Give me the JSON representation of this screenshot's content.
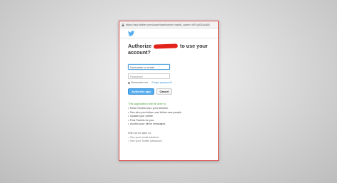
{
  "browser": {
    "url": "https://api.twitter.com/oauth/authorize?oauth_token=WCqXDAAAA"
  },
  "brand": {
    "logo_icon": "twitter-bird-icon",
    "color": "#55acee"
  },
  "auth": {
    "title_before": "Authorize",
    "title_after": "to use your",
    "title_line2": "account?"
  },
  "form": {
    "username_placeholder": "Username or email",
    "password_placeholder": "Password",
    "remember_label": "Remember me",
    "separator": "·",
    "forgot_label": "Forgot password?"
  },
  "buttons": {
    "authorize_label": "Authorize app",
    "cancel_label": "Cancel"
  },
  "permissions": {
    "able_title": "This application will be able to:",
    "able": [
      "Read Tweets from your timeline.",
      "See who you follow, and follow new people.",
      "Update your profile.",
      "Post Tweets for you.",
      "Access your direct messages."
    ],
    "not_able_title": "Will not be able to:",
    "not_able": [
      "See your email address.",
      "See your Twitter password."
    ]
  },
  "colors": {
    "redaction": "#e2231a",
    "able_title": "#4a9d3b",
    "link": "#3b94d9",
    "border": "#d9534f"
  }
}
